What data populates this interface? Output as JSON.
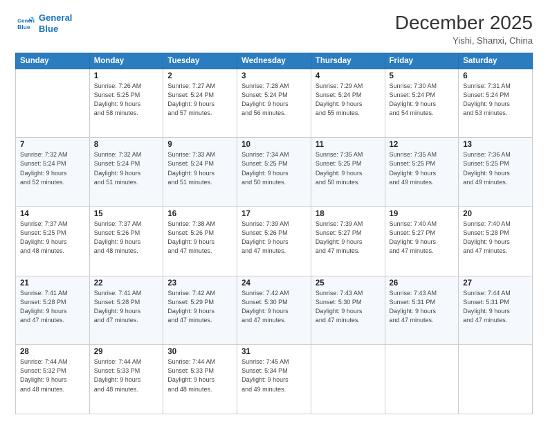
{
  "header": {
    "logo_line1": "General",
    "logo_line2": "Blue",
    "month": "December 2025",
    "location": "Yishi, Shanxi, China"
  },
  "weekdays": [
    "Sunday",
    "Monday",
    "Tuesday",
    "Wednesday",
    "Thursday",
    "Friday",
    "Saturday"
  ],
  "weeks": [
    [
      {
        "day": "",
        "info": ""
      },
      {
        "day": "1",
        "info": "Sunrise: 7:26 AM\nSunset: 5:25 PM\nDaylight: 9 hours\nand 58 minutes."
      },
      {
        "day": "2",
        "info": "Sunrise: 7:27 AM\nSunset: 5:24 PM\nDaylight: 9 hours\nand 57 minutes."
      },
      {
        "day": "3",
        "info": "Sunrise: 7:28 AM\nSunset: 5:24 PM\nDaylight: 9 hours\nand 56 minutes."
      },
      {
        "day": "4",
        "info": "Sunrise: 7:29 AM\nSunset: 5:24 PM\nDaylight: 9 hours\nand 55 minutes."
      },
      {
        "day": "5",
        "info": "Sunrise: 7:30 AM\nSunset: 5:24 PM\nDaylight: 9 hours\nand 54 minutes."
      },
      {
        "day": "6",
        "info": "Sunrise: 7:31 AM\nSunset: 5:24 PM\nDaylight: 9 hours\nand 53 minutes."
      }
    ],
    [
      {
        "day": "7",
        "info": "Sunrise: 7:32 AM\nSunset: 5:24 PM\nDaylight: 9 hours\nand 52 minutes."
      },
      {
        "day": "8",
        "info": "Sunrise: 7:32 AM\nSunset: 5:24 PM\nDaylight: 9 hours\nand 51 minutes."
      },
      {
        "day": "9",
        "info": "Sunrise: 7:33 AM\nSunset: 5:24 PM\nDaylight: 9 hours\nand 51 minutes."
      },
      {
        "day": "10",
        "info": "Sunrise: 7:34 AM\nSunset: 5:25 PM\nDaylight: 9 hours\nand 50 minutes."
      },
      {
        "day": "11",
        "info": "Sunrise: 7:35 AM\nSunset: 5:25 PM\nDaylight: 9 hours\nand 50 minutes."
      },
      {
        "day": "12",
        "info": "Sunrise: 7:35 AM\nSunset: 5:25 PM\nDaylight: 9 hours\nand 49 minutes."
      },
      {
        "day": "13",
        "info": "Sunrise: 7:36 AM\nSunset: 5:25 PM\nDaylight: 9 hours\nand 49 minutes."
      }
    ],
    [
      {
        "day": "14",
        "info": "Sunrise: 7:37 AM\nSunset: 5:25 PM\nDaylight: 9 hours\nand 48 minutes."
      },
      {
        "day": "15",
        "info": "Sunrise: 7:37 AM\nSunset: 5:26 PM\nDaylight: 9 hours\nand 48 minutes."
      },
      {
        "day": "16",
        "info": "Sunrise: 7:38 AM\nSunset: 5:26 PM\nDaylight: 9 hours\nand 47 minutes."
      },
      {
        "day": "17",
        "info": "Sunrise: 7:39 AM\nSunset: 5:26 PM\nDaylight: 9 hours\nand 47 minutes."
      },
      {
        "day": "18",
        "info": "Sunrise: 7:39 AM\nSunset: 5:27 PM\nDaylight: 9 hours\nand 47 minutes."
      },
      {
        "day": "19",
        "info": "Sunrise: 7:40 AM\nSunset: 5:27 PM\nDaylight: 9 hours\nand 47 minutes."
      },
      {
        "day": "20",
        "info": "Sunrise: 7:40 AM\nSunset: 5:28 PM\nDaylight: 9 hours\nand 47 minutes."
      }
    ],
    [
      {
        "day": "21",
        "info": "Sunrise: 7:41 AM\nSunset: 5:28 PM\nDaylight: 9 hours\nand 47 minutes."
      },
      {
        "day": "22",
        "info": "Sunrise: 7:41 AM\nSunset: 5:28 PM\nDaylight: 9 hours\nand 47 minutes."
      },
      {
        "day": "23",
        "info": "Sunrise: 7:42 AM\nSunset: 5:29 PM\nDaylight: 9 hours\nand 47 minutes."
      },
      {
        "day": "24",
        "info": "Sunrise: 7:42 AM\nSunset: 5:30 PM\nDaylight: 9 hours\nand 47 minutes."
      },
      {
        "day": "25",
        "info": "Sunrise: 7:43 AM\nSunset: 5:30 PM\nDaylight: 9 hours\nand 47 minutes."
      },
      {
        "day": "26",
        "info": "Sunrise: 7:43 AM\nSunset: 5:31 PM\nDaylight: 9 hours\nand 47 minutes."
      },
      {
        "day": "27",
        "info": "Sunrise: 7:44 AM\nSunset: 5:31 PM\nDaylight: 9 hours\nand 47 minutes."
      }
    ],
    [
      {
        "day": "28",
        "info": "Sunrise: 7:44 AM\nSunset: 5:32 PM\nDaylight: 9 hours\nand 48 minutes."
      },
      {
        "day": "29",
        "info": "Sunrise: 7:44 AM\nSunset: 5:33 PM\nDaylight: 9 hours\nand 48 minutes."
      },
      {
        "day": "30",
        "info": "Sunrise: 7:44 AM\nSunset: 5:33 PM\nDaylight: 9 hours\nand 48 minutes."
      },
      {
        "day": "31",
        "info": "Sunrise: 7:45 AM\nSunset: 5:34 PM\nDaylight: 9 hours\nand 49 minutes."
      },
      {
        "day": "",
        "info": ""
      },
      {
        "day": "",
        "info": ""
      },
      {
        "day": "",
        "info": ""
      }
    ]
  ]
}
